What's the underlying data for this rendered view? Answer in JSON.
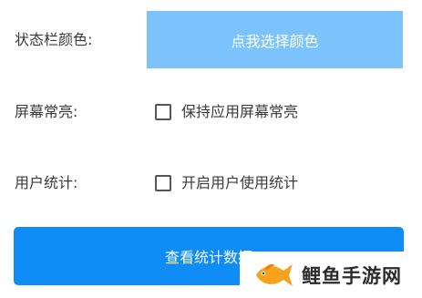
{
  "settings": {
    "status_bar_color": {
      "label": "状态栏颜色:",
      "button_label": "点我选择颜色",
      "button_color": "#7cc3fc"
    },
    "keep_screen_on": {
      "label": "屏幕常亮:",
      "checkbox_label": "保持应用屏幕常亮",
      "checked": false
    },
    "user_statistics": {
      "label": "用户统计:",
      "checkbox_label": "开启用户使用统计",
      "checked": false
    }
  },
  "actions": {
    "view_stats_label": "查看统计数据",
    "primary_color": "#0f8cf5"
  },
  "watermark": {
    "text": "鲤鱼手游网",
    "icon": "fish-logo-icon"
  }
}
